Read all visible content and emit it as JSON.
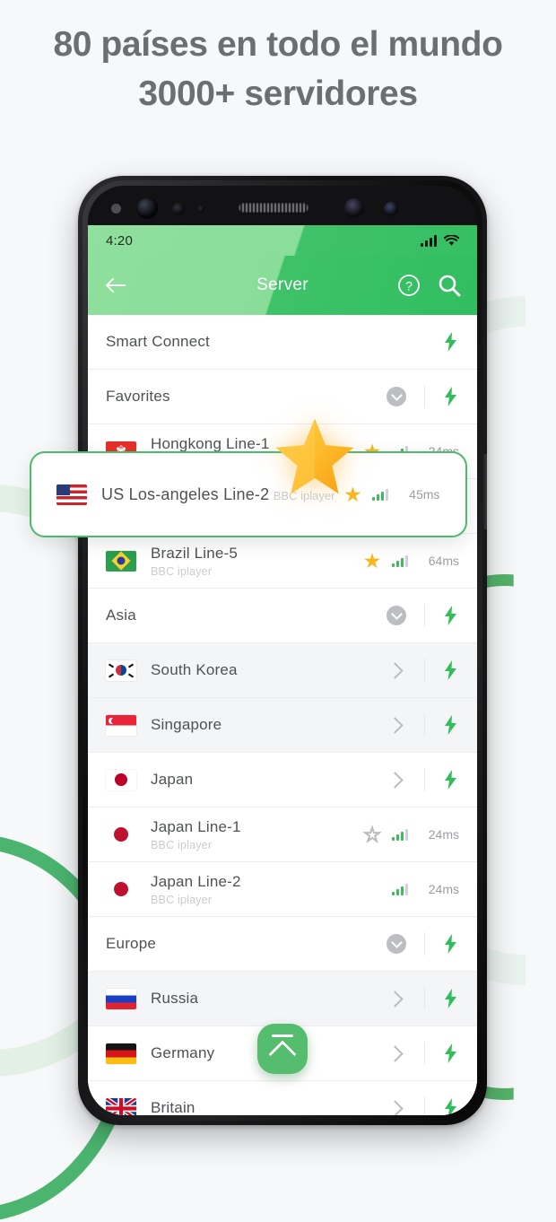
{
  "headline": {
    "line1": "80 países en todo el mundo",
    "line2": "3000+ servidores"
  },
  "colors": {
    "accent_green": "#3fc269",
    "header_light_green": "#8fdf9d",
    "star_gold": "#f6b81e",
    "text_gray": "#4e5255",
    "subtext_gray": "#c9ccd0",
    "background": "#f7f8fa"
  },
  "phone": {
    "statusbar": {
      "time": "4:20",
      "signal_icon": "cellular-signal-icon",
      "wifi_icon": "wifi-icon"
    },
    "appbar": {
      "back_icon": "back-arrow-icon",
      "title": "Server",
      "help_icon": "help-circle-icon",
      "search_icon": "search-icon"
    },
    "fab": {
      "icon": "double-chevron-up-icon",
      "label": "Scroll to top"
    },
    "rows": [
      {
        "type": "simple",
        "label": "Smart Connect",
        "bolt": true
      },
      {
        "type": "group",
        "label": "Favorites",
        "expand_icon": "chevron-down-circle-icon",
        "bolt": true
      },
      {
        "type": "server",
        "flag": "hk",
        "label": "Hongkong Line-1",
        "sub": "BBC iplayer",
        "star": "filled",
        "signal": 3,
        "ping": "24ms"
      },
      {
        "type": "server",
        "flag": "us",
        "label": "US Los-angeles Line-2",
        "sub": "BBC iplayer",
        "star": "filled",
        "signal": 3,
        "ping": "45ms"
      },
      {
        "type": "server",
        "flag": "br",
        "label": "Brazil Line-5",
        "sub": "BBC iplayer",
        "star": "filled",
        "signal": 3,
        "ping": "64ms"
      },
      {
        "type": "group",
        "label": "Asia",
        "expand_icon": "chevron-down-circle-icon",
        "bolt": true
      },
      {
        "type": "country",
        "flag": "kr",
        "label": "South Korea",
        "chevron": "chevron-right-icon",
        "bolt": true
      },
      {
        "type": "country",
        "flag": "sg",
        "label": "Singapore",
        "chevron": "chevron-right-icon",
        "bolt": true
      },
      {
        "type": "country",
        "flag": "jp",
        "label": "Japan",
        "chevron": "chevron-right-icon",
        "bolt": true
      },
      {
        "type": "server",
        "flag": "jp-dot",
        "label": "Japan Line-1",
        "sub": "BBC iplayer",
        "star": "empty",
        "signal": 3,
        "ping": "24ms"
      },
      {
        "type": "server",
        "flag": "jp-dot",
        "label": "Japan Line-2",
        "sub": "BBC iplayer",
        "star": "none",
        "signal": 3,
        "ping": "24ms"
      },
      {
        "type": "group",
        "label": "Europe",
        "expand_icon": "chevron-down-circle-icon",
        "bolt": true
      },
      {
        "type": "country",
        "flag": "ru",
        "label": "Russia",
        "chevron": "chevron-right-icon",
        "bolt": true
      },
      {
        "type": "country",
        "flag": "de",
        "label": "Germany",
        "chevron": "chevron-right-icon",
        "bolt": true
      },
      {
        "type": "country",
        "flag": "gb",
        "label": "Britain",
        "chevron": "chevron-right-icon",
        "bolt": true
      }
    ]
  },
  "callout": {
    "flag": "us",
    "label": "US Los-angeles Line-2",
    "sub": "BBC iplayer",
    "star_icon": "star-filled-icon",
    "signal_icon": "signal-bars-icon",
    "ping": "45ms",
    "decoration_icon": "big-star-icon"
  }
}
